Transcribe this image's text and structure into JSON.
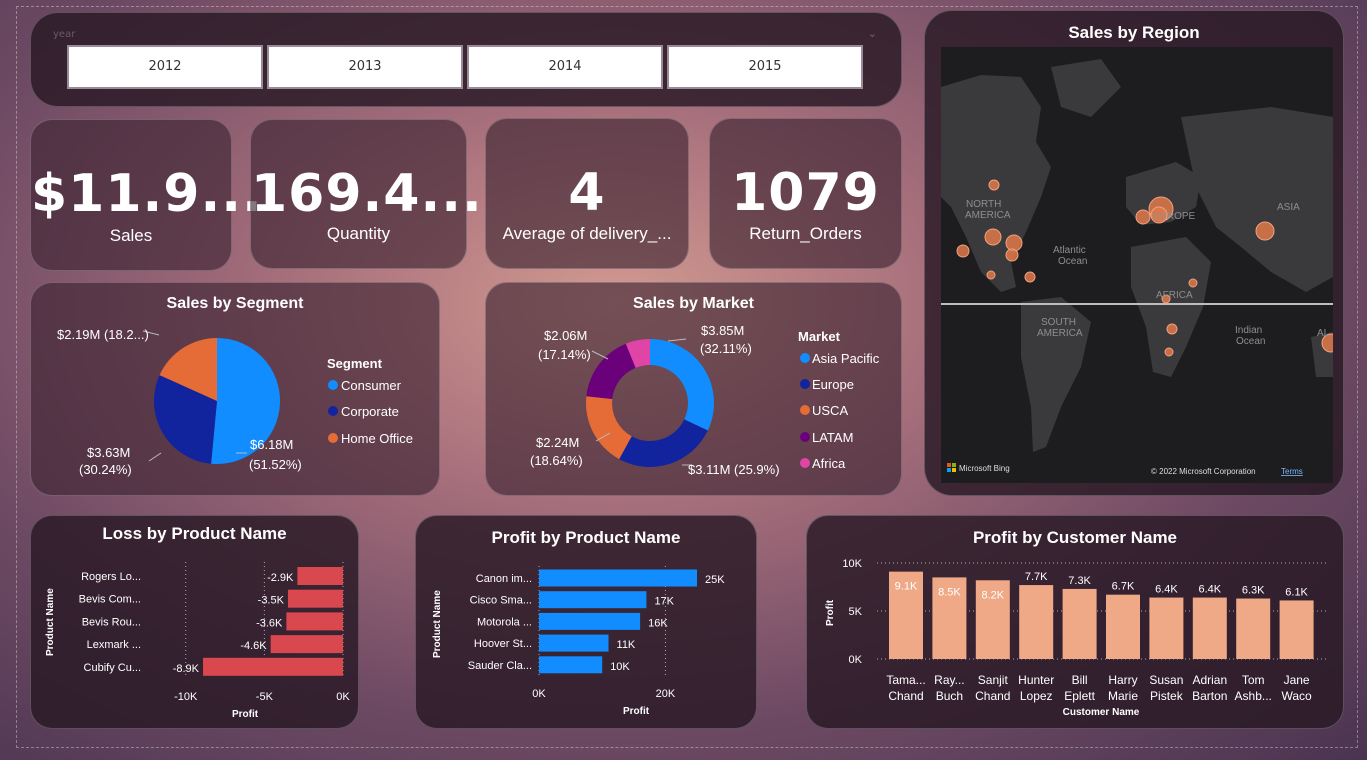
{
  "slicer": {
    "label": "year",
    "years": [
      "2012",
      "2013",
      "2014",
      "2015"
    ]
  },
  "kpis": [
    {
      "value": "$11.9...",
      "label": "Sales"
    },
    {
      "value": "169.4...",
      "label": "Quantity"
    },
    {
      "value": "4",
      "label": "Average of delivery_..."
    },
    {
      "value": "1079",
      "label": "Return_Orders"
    }
  ],
  "map": {
    "title": "Sales by Region",
    "labels": [
      "NORTH",
      "AMERICA",
      "EUROPE",
      "ASIA",
      "Atlantic",
      "Ocean",
      "AFRICA",
      "SOUTH",
      "AMERICA",
      "Indian",
      "Ocean",
      "AL"
    ],
    "brand": "Microsoft Bing",
    "copyright": "© 2022 Microsoft Corporation",
    "terms": "Terms"
  },
  "segment": {
    "title": "Sales by Segment",
    "legend_title": "Segment",
    "legend": [
      "Consumer",
      "Corporate",
      "Home Office"
    ],
    "labels": [
      "$2.19M (18.2...)",
      "$3.63M",
      "(30.24%)",
      "$6.18M",
      "(51.52%)"
    ]
  },
  "market": {
    "title": "Sales by Market",
    "legend_title": "Market",
    "legend": [
      "Asia Pacific",
      "Europe",
      "USCA",
      "LATAM",
      "Africa"
    ],
    "labels": [
      "$3.85M",
      "(32.11%)",
      "$2.06M",
      "(17.14%)",
      "$2.24M",
      "(18.64%)",
      "$3.11M (25.9%)"
    ]
  },
  "loss": {
    "title": "Loss by Product Name",
    "ylabel": "Product Name",
    "xlabel": "Profit",
    "ticks": [
      "-10K",
      "-5K",
      "0K"
    ],
    "products": [
      "Rogers Lo...",
      "Bevis Com...",
      "Bevis Rou...",
      "Lexmark ...",
      "Cubify Cu..."
    ],
    "value_labels": [
      "-2.9K",
      "-3.5K",
      "-3.6K",
      "-4.6K",
      "-8.9K"
    ]
  },
  "profit_product": {
    "title": "Profit by Product Name",
    "ylabel": "Product Name",
    "xlabel": "Profit",
    "ticks": [
      "0K",
      "20K"
    ],
    "products": [
      "Canon im...",
      "Cisco Sma...",
      "Motorola ...",
      "Hoover St...",
      "Sauder Cla..."
    ],
    "value_labels": [
      "25K",
      "17K",
      "16K",
      "11K",
      "10K"
    ]
  },
  "profit_customer": {
    "title": "Profit by Customer Name",
    "ylabel": "Profit",
    "xlabel": "Customer Name",
    "ticks": [
      "10K",
      "5K",
      "0K"
    ],
    "names": [
      [
        "Tama...",
        "Chand"
      ],
      [
        "Ray...",
        "Buch"
      ],
      [
        "Sanjit",
        "Chand"
      ],
      [
        "Hunter",
        "Lopez"
      ],
      [
        "Bill",
        "Eplett"
      ],
      [
        "Harry",
        "Marie"
      ],
      [
        "Susan",
        "Pistek"
      ],
      [
        "Adrian",
        "Barton"
      ],
      [
        "Tom",
        "Ashb..."
      ],
      [
        "Jane",
        "Waco"
      ]
    ],
    "value_labels": [
      "9.1K",
      "8.5K",
      "8.2K",
      "7.7K",
      "7.3K",
      "6.7K",
      "6.4K",
      "6.4K",
      "6.3K",
      "6.1K"
    ]
  },
  "chart_data": [
    {
      "type": "pie",
      "title": "Sales by Segment",
      "categories": [
        "Consumer",
        "Corporate",
        "Home Office"
      ],
      "values": [
        6.18,
        3.63,
        2.19
      ],
      "percent": [
        51.52,
        30.24,
        18.24
      ],
      "unit": "$M",
      "legend": "right"
    },
    {
      "type": "pie",
      "title": "Sales by Market",
      "categories": [
        "Asia Pacific",
        "Europe",
        "USCA",
        "LATAM",
        "Africa"
      ],
      "values": [
        3.85,
        3.11,
        2.24,
        2.06,
        0.74
      ],
      "percent": [
        32.11,
        25.9,
        18.64,
        17.14,
        6.21
      ],
      "unit": "$M",
      "donut": true,
      "legend": "right"
    },
    {
      "type": "bar",
      "orientation": "horizontal",
      "title": "Loss by Product Name",
      "categories": [
        "Rogers Lo...",
        "Bevis Com...",
        "Bevis Rou...",
        "Lexmark ...",
        "Cubify Cu..."
      ],
      "values": [
        -2900,
        -3500,
        -3600,
        -4600,
        -8900
      ],
      "xlim": [
        -11000,
        0
      ],
      "xlabel": "Profit",
      "ylabel": "Product Name"
    },
    {
      "type": "bar",
      "orientation": "horizontal",
      "title": "Profit by Product Name",
      "categories": [
        "Canon im...",
        "Cisco Sma...",
        "Motorola ...",
        "Hoover St...",
        "Sauder Cla..."
      ],
      "values": [
        25000,
        17000,
        16000,
        11000,
        10000
      ],
      "xlim": [
        0,
        25000
      ],
      "xlabel": "Profit",
      "ylabel": "Product Name"
    },
    {
      "type": "bar",
      "title": "Profit by Customer Name",
      "categories": [
        "Tama... Chand",
        "Ray... Buch",
        "Sanjit Chand",
        "Hunter Lopez",
        "Bill Eplett",
        "Harry Marie",
        "Susan Pistek",
        "Adrian Barton",
        "Tom Ashb...",
        "Jane Waco"
      ],
      "values": [
        9100,
        8500,
        8200,
        7700,
        7300,
        6700,
        6400,
        6400,
        6300,
        6100
      ],
      "ylim": [
        0,
        10000
      ],
      "xlabel": "Customer Name",
      "ylabel": "Profit"
    }
  ],
  "colors": {
    "consumer": "#118dff",
    "corporate": "#12239e",
    "home_office": "#e66c37",
    "asia_pacific": "#118dff",
    "europe": "#12239e",
    "usca": "#e66c37",
    "latam": "#6b007b",
    "africa": "#e044a7",
    "loss_bar": "#d9474f",
    "profit_bar": "#118dff",
    "customer_bar": "#f0a987",
    "bubble": "#e07a4a"
  }
}
